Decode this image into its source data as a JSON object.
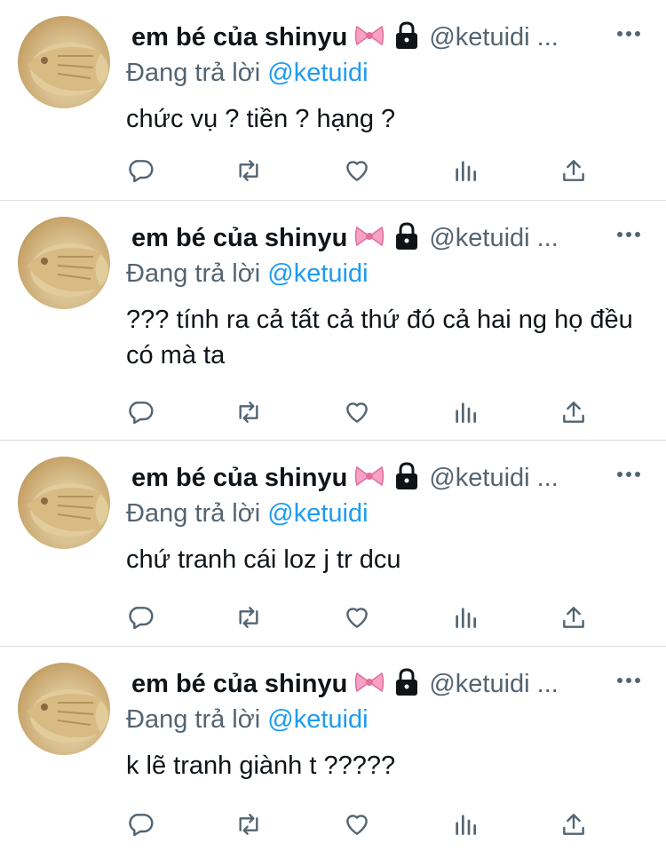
{
  "colors": {
    "text": "#0f1419",
    "secondary": "#536471",
    "accent": "#1d9bf0",
    "divider": "#d9dde1"
  },
  "icons": {
    "bow": "ribbon-bow-icon",
    "lock": "padlock-icon",
    "more": "more-dots-icon",
    "reply": "reply-icon",
    "retweet": "retweet-icon",
    "like": "heart-icon",
    "views": "views-icon",
    "share": "share-icon"
  },
  "tweets": [
    {
      "name": "em bé của shinyu",
      "handle": "@ketuidi ...",
      "replying_prefix": "Đang trả lời",
      "replying_to": "@ketuidi",
      "text": "chức vụ ? tiền ? hạng ?"
    },
    {
      "name": "em bé của shinyu",
      "handle": "@ketuidi ...",
      "replying_prefix": "Đang trả lời",
      "replying_to": "@ketuidi",
      "text": "??? tính ra cả tất cả thứ đó cả hai ng họ đều có mà ta"
    },
    {
      "name": "em bé của shinyu",
      "handle": "@ketuidi ...",
      "replying_prefix": "Đang trả lời",
      "replying_to": "@ketuidi",
      "text": "chứ tranh cái loz j tr dcu"
    },
    {
      "name": "em bé của shinyu",
      "handle": "@ketuidi ...",
      "replying_prefix": "Đang trả lời",
      "replying_to": "@ketuidi",
      "text": "k lẽ tranh giành t ?????"
    }
  ]
}
